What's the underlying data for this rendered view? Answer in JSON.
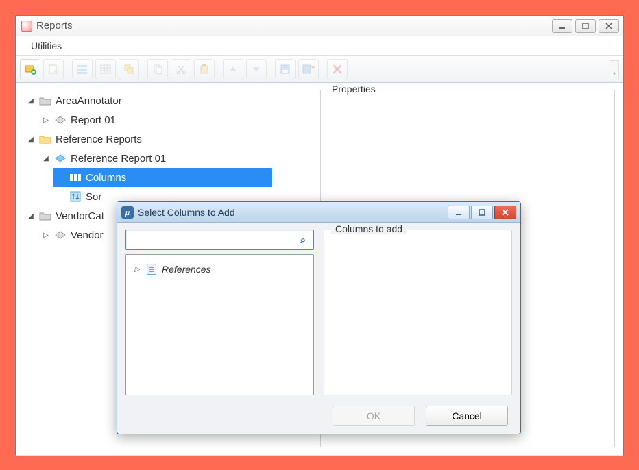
{
  "window": {
    "title": "Reports"
  },
  "menubar": {
    "utilities": "Utilities"
  },
  "toolbar": {
    "items": [
      "new-report",
      "new-item",
      "list-view",
      "grid-view",
      "relink",
      "copy",
      "cut",
      "paste",
      "move-up",
      "move-down",
      "save",
      "save-as",
      "delete"
    ]
  },
  "tree": {
    "nodes": [
      {
        "id": "area",
        "label": "AreaAnnotator",
        "icon": "folder-open-gray",
        "expanded": true,
        "children": [
          {
            "id": "rpt01",
            "label": "Report 01",
            "icon": "report-gray",
            "hasChildren": true
          }
        ]
      },
      {
        "id": "refreps",
        "label": "Reference Reports",
        "icon": "folder-open-yellow",
        "expanded": true,
        "children": [
          {
            "id": "refrep01",
            "label": "Reference Report 01",
            "icon": "report-blue",
            "expanded": true,
            "children": [
              {
                "id": "cols",
                "label": "Columns",
                "icon": "columns-white",
                "selected": true
              },
              {
                "id": "sort",
                "label": "Sor",
                "icon": "sort-blue"
              }
            ]
          }
        ]
      },
      {
        "id": "vendorcat",
        "label": "VendorCat",
        "icon": "folder-open-gray",
        "expanded": true,
        "truncated": true,
        "children": [
          {
            "id": "vendor",
            "label": "Vendor",
            "icon": "report-gray",
            "hasChildren": true,
            "truncated": true
          }
        ]
      }
    ]
  },
  "properties": {
    "title": "Properties"
  },
  "dialog": {
    "title": "Select Columns to Add",
    "search_placeholder": "",
    "left_items": [
      {
        "label": "References"
      }
    ],
    "right_title": "Columns to add",
    "ok": "OK",
    "cancel": "Cancel",
    "ok_enabled": false
  }
}
